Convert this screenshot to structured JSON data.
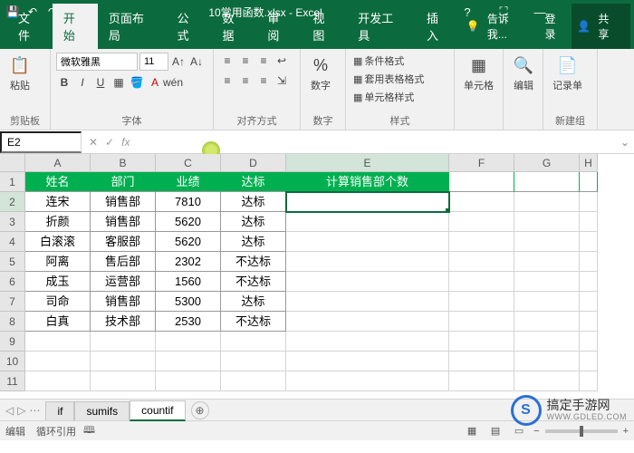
{
  "app": {
    "title": "10常用函数.xlsx - Excel"
  },
  "qat": {
    "save": "💾",
    "undo": "↶",
    "redo": "↷",
    "more": "▾"
  },
  "win": {
    "help": "?",
    "full": "⛶",
    "min": "—",
    "max": "☐",
    "close": "✕"
  },
  "tabs": {
    "file": "文件",
    "home": "开始",
    "layout": "页面布局",
    "formula": "公式",
    "data": "数据",
    "review": "审阅",
    "view": "视图",
    "dev": "开发工具",
    "insert": "插入",
    "tell": "告诉我...",
    "login": "登录",
    "share": "共享"
  },
  "ribbon": {
    "paste": "粘贴",
    "clipboard": "剪贴板",
    "font_name": "微软雅黑",
    "font_size": "11",
    "font": "字体",
    "align": "对齐方式",
    "number": "数字",
    "percent": "%",
    "cond_fmt": "条件格式",
    "table_fmt": "套用表格格式",
    "cell_style": "单元格样式",
    "styles": "样式",
    "cells": "单元格",
    "edit": "编辑",
    "record": "记录单",
    "newgroup": "新建组",
    "B": "B",
    "I": "I",
    "U": "U"
  },
  "namebox": "E2",
  "fx": {
    "cancel": "✕",
    "enter": "✓",
    "fx": "fx"
  },
  "formula": "",
  "cols": [
    "A",
    "B",
    "C",
    "D",
    "E",
    "F",
    "G",
    "H"
  ],
  "rowNums": [
    "1",
    "2",
    "3",
    "4",
    "5",
    "6",
    "7",
    "8",
    "9",
    "10",
    "11"
  ],
  "header": {
    "A": "姓名",
    "B": "部门",
    "C": "业绩",
    "D": "达标",
    "E": "计算销售部个数"
  },
  "data_rows": [
    {
      "A": "连宋",
      "B": "销售部",
      "C": "7810",
      "D": "达标"
    },
    {
      "A": "折颜",
      "B": "销售部",
      "C": "5620",
      "D": "达标"
    },
    {
      "A": "白滚滚",
      "B": "客服部",
      "C": "5620",
      "D": "达标"
    },
    {
      "A": "阿离",
      "B": "售后部",
      "C": "2302",
      "D": "不达标"
    },
    {
      "A": "成玉",
      "B": "运营部",
      "C": "1560",
      "D": "不达标"
    },
    {
      "A": "司命",
      "B": "销售部",
      "C": "5300",
      "D": "达标"
    },
    {
      "A": "白真",
      "B": "技术部",
      "C": "2530",
      "D": "不达标"
    }
  ],
  "sheets": {
    "nav_prev": "◁",
    "nav_next": "▷",
    "dots": "⋯",
    "if": "if",
    "sumifs": "sumifs",
    "countif": "countif",
    "add": "⊕"
  },
  "status": {
    "mode": "编辑",
    "circ": "循环引用",
    "book": "🕮",
    "zoom": "+ 100%",
    "minus": "−",
    "plus": "+"
  },
  "watermark": {
    "brand": "搞定手游网",
    "url": "WWW.GDLED.COM"
  }
}
